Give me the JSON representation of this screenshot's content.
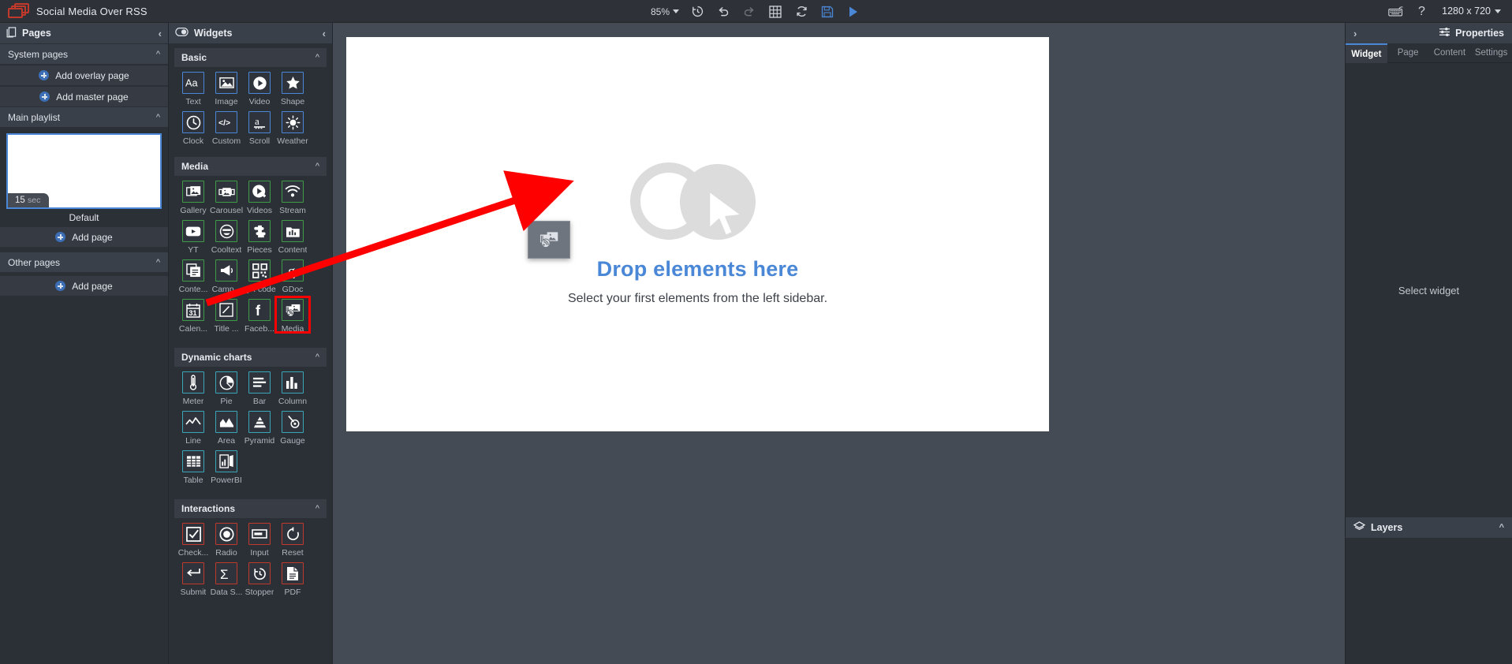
{
  "topbar": {
    "logo_icon": "screens-logo-icon",
    "title": "Social Media Over RSS",
    "zoom_level": "85%",
    "tools": [
      {
        "name": "history-icon",
        "label": "History"
      },
      {
        "name": "undo-icon",
        "label": "Undo"
      },
      {
        "name": "redo-icon",
        "label": "Redo"
      },
      {
        "name": "grid-icon",
        "label": "Grid"
      },
      {
        "name": "refresh-icon",
        "label": "Refresh"
      },
      {
        "name": "save-icon",
        "label": "Save"
      },
      {
        "name": "play-icon",
        "label": "Preview"
      }
    ],
    "keyboard_icon": "keyboard-icon",
    "help_icon": "help-question-icon",
    "resolution": "1280 x 720"
  },
  "pages_panel": {
    "title": "Pages",
    "icon": "pages-icon",
    "collapse_icon": "chevron-left-icon",
    "sections": [
      {
        "label": "System pages",
        "chevron": "chevron-up-icon"
      },
      {
        "label": "Main playlist",
        "chevron": "chevron-up-icon"
      },
      {
        "label": "Other pages",
        "chevron": "chevron-up-icon"
      }
    ],
    "system_buttons": [
      {
        "label": "Add overlay page",
        "icon": "plus-circle-icon"
      },
      {
        "label": "Add master page",
        "icon": "plus-circle-icon"
      }
    ],
    "page_thumb": {
      "duration_value": "15",
      "duration_unit": "sec",
      "name": "Default"
    },
    "add_page_main": {
      "label": "Add page",
      "icon": "plus-circle-icon"
    },
    "add_page_other": {
      "label": "Add page",
      "icon": "plus-circle-icon"
    }
  },
  "widgets_panel": {
    "title": "Widgets",
    "icon": "widgets-toggle-icon",
    "collapse_icon": "chevron-left-icon",
    "categories": [
      {
        "name": "Basic",
        "color": "#4a87d6",
        "chevron": "chevron-up-icon",
        "items": [
          {
            "label": "Text",
            "icon": "text-aa-icon"
          },
          {
            "label": "Image",
            "icon": "image-icon"
          },
          {
            "label": "Video",
            "icon": "video-play-icon"
          },
          {
            "label": "Shape",
            "icon": "star-shape-icon"
          },
          {
            "label": "Clock",
            "icon": "clock-icon"
          },
          {
            "label": "Custom",
            "icon": "code-brackets-icon"
          },
          {
            "label": "Scroll",
            "icon": "scroll-text-icon"
          },
          {
            "label": "Weather",
            "icon": "weather-sun-icon"
          }
        ]
      },
      {
        "name": "Media",
        "color": "#3f9c46",
        "chevron": "chevron-up-icon",
        "items": [
          {
            "label": "Gallery",
            "icon": "gallery-icon"
          },
          {
            "label": "Carousel",
            "icon": "carousel-icon"
          },
          {
            "label": "Videos",
            "icon": "videos-plus-icon"
          },
          {
            "label": "Stream",
            "icon": "stream-wifi-icon"
          },
          {
            "label": "YT",
            "icon": "youtube-icon"
          },
          {
            "label": "Cooltext",
            "icon": "cooltext-smiley-icon"
          },
          {
            "label": "Pieces",
            "icon": "puzzle-piece-icon"
          },
          {
            "label": "Content",
            "icon": "content-chart-icon"
          },
          {
            "label": "Conte...",
            "icon": "content-copy-icon"
          },
          {
            "label": "Camp...",
            "icon": "campaign-icon"
          },
          {
            "label": "QR code",
            "icon": "qr-code-icon"
          },
          {
            "label": "GDoc",
            "icon": "google-doc-icon"
          },
          {
            "label": "Calen...",
            "icon": "calendar-31-icon"
          },
          {
            "label": "Title ...",
            "icon": "title-pencil-icon"
          },
          {
            "label": "Faceb...",
            "icon": "facebook-icon"
          },
          {
            "label": "Media",
            "icon": "media-rss-icon",
            "highlighted": true
          }
        ]
      },
      {
        "name": "Dynamic charts",
        "color": "#3aa7b8",
        "chevron": "chevron-up-icon",
        "items": [
          {
            "label": "Meter",
            "icon": "meter-thermometer-icon"
          },
          {
            "label": "Pie",
            "icon": "pie-chart-icon"
          },
          {
            "label": "Bar",
            "icon": "bar-chart-icon"
          },
          {
            "label": "Column",
            "icon": "column-chart-icon"
          },
          {
            "label": "Line",
            "icon": "line-chart-icon"
          },
          {
            "label": "Area",
            "icon": "area-chart-icon"
          },
          {
            "label": "Pyramid",
            "icon": "pyramid-chart-icon"
          },
          {
            "label": "Gauge",
            "icon": "gauge-icon"
          },
          {
            "label": "Table",
            "icon": "table-grid-icon"
          },
          {
            "label": "PowerBI",
            "icon": "powerbi-icon"
          }
        ]
      },
      {
        "name": "Interactions",
        "color": "#c0392b",
        "chevron": "chevron-up-icon",
        "items": [
          {
            "label": "Check...",
            "icon": "checkbox-icon"
          },
          {
            "label": "Radio",
            "icon": "radio-button-icon"
          },
          {
            "label": "Input",
            "icon": "input-field-icon"
          },
          {
            "label": "Reset",
            "icon": "reset-circular-arrow-icon"
          },
          {
            "label": "Submit",
            "icon": "submit-arrow-icon"
          },
          {
            "label": "Data S...",
            "icon": "sigma-sum-icon"
          },
          {
            "label": "Stopper",
            "icon": "stopwatch-icon"
          },
          {
            "label": "PDF",
            "icon": "pdf-document-icon"
          }
        ]
      }
    ]
  },
  "canvas": {
    "drop_title": "Drop elements here",
    "drop_subtitle": "Select your first elements from the left sidebar.",
    "placeholder_icon": "cursor-arrow-icon",
    "dragged_widget_icon": "media-rss-icon"
  },
  "properties_panel": {
    "title": "Properties",
    "icon": "sliders-icon",
    "expand_icon": "chevron-right-icon",
    "tabs": [
      {
        "label": "Widget",
        "active": true
      },
      {
        "label": "Page",
        "active": false
      },
      {
        "label": "Content",
        "active": false
      },
      {
        "label": "Settings",
        "active": false
      }
    ],
    "empty_message": "Select widget",
    "layers": {
      "title": "Layers",
      "icon": "layers-icon",
      "chevron": "chevron-up-icon"
    }
  },
  "annotation": {
    "arrow_color": "#ff0000",
    "highlight_color": "#ff0000"
  }
}
